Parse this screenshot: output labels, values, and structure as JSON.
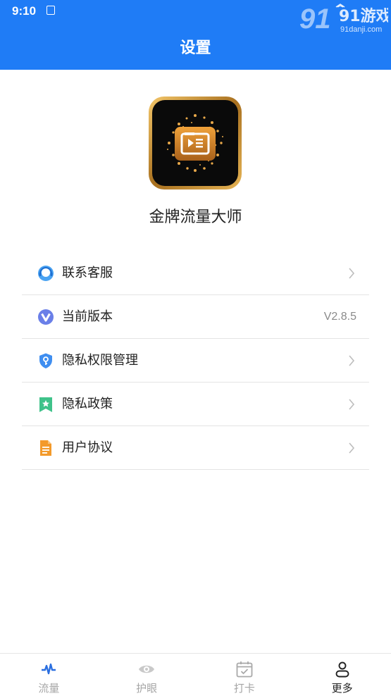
{
  "status": {
    "time": "9:10"
  },
  "watermark": {
    "logo": "91游戏",
    "site": "91danji.com"
  },
  "header": {
    "title": "设置"
  },
  "app": {
    "name": "金牌流量大师"
  },
  "menu": [
    {
      "label": "联系客服",
      "icon": "customer-service-icon",
      "value": ""
    },
    {
      "label": "当前版本",
      "icon": "version-icon",
      "value": "V2.8.5"
    },
    {
      "label": "隐私权限管理",
      "icon": "shield-key-icon",
      "value": ""
    },
    {
      "label": "隐私政策",
      "icon": "bookmark-star-icon",
      "value": ""
    },
    {
      "label": "用户协议",
      "icon": "document-icon",
      "value": ""
    }
  ],
  "tabs": [
    {
      "label": "流量",
      "icon": "pulse-icon"
    },
    {
      "label": "护眼",
      "icon": "eye-icon"
    },
    {
      "label": "打卡",
      "icon": "calendar-check-icon"
    },
    {
      "label": "更多",
      "icon": "user-icon",
      "active": true
    }
  ],
  "colors": {
    "primary": "#1f7cf6",
    "gold": "#c98a2c",
    "divider": "#e4e4e4"
  }
}
